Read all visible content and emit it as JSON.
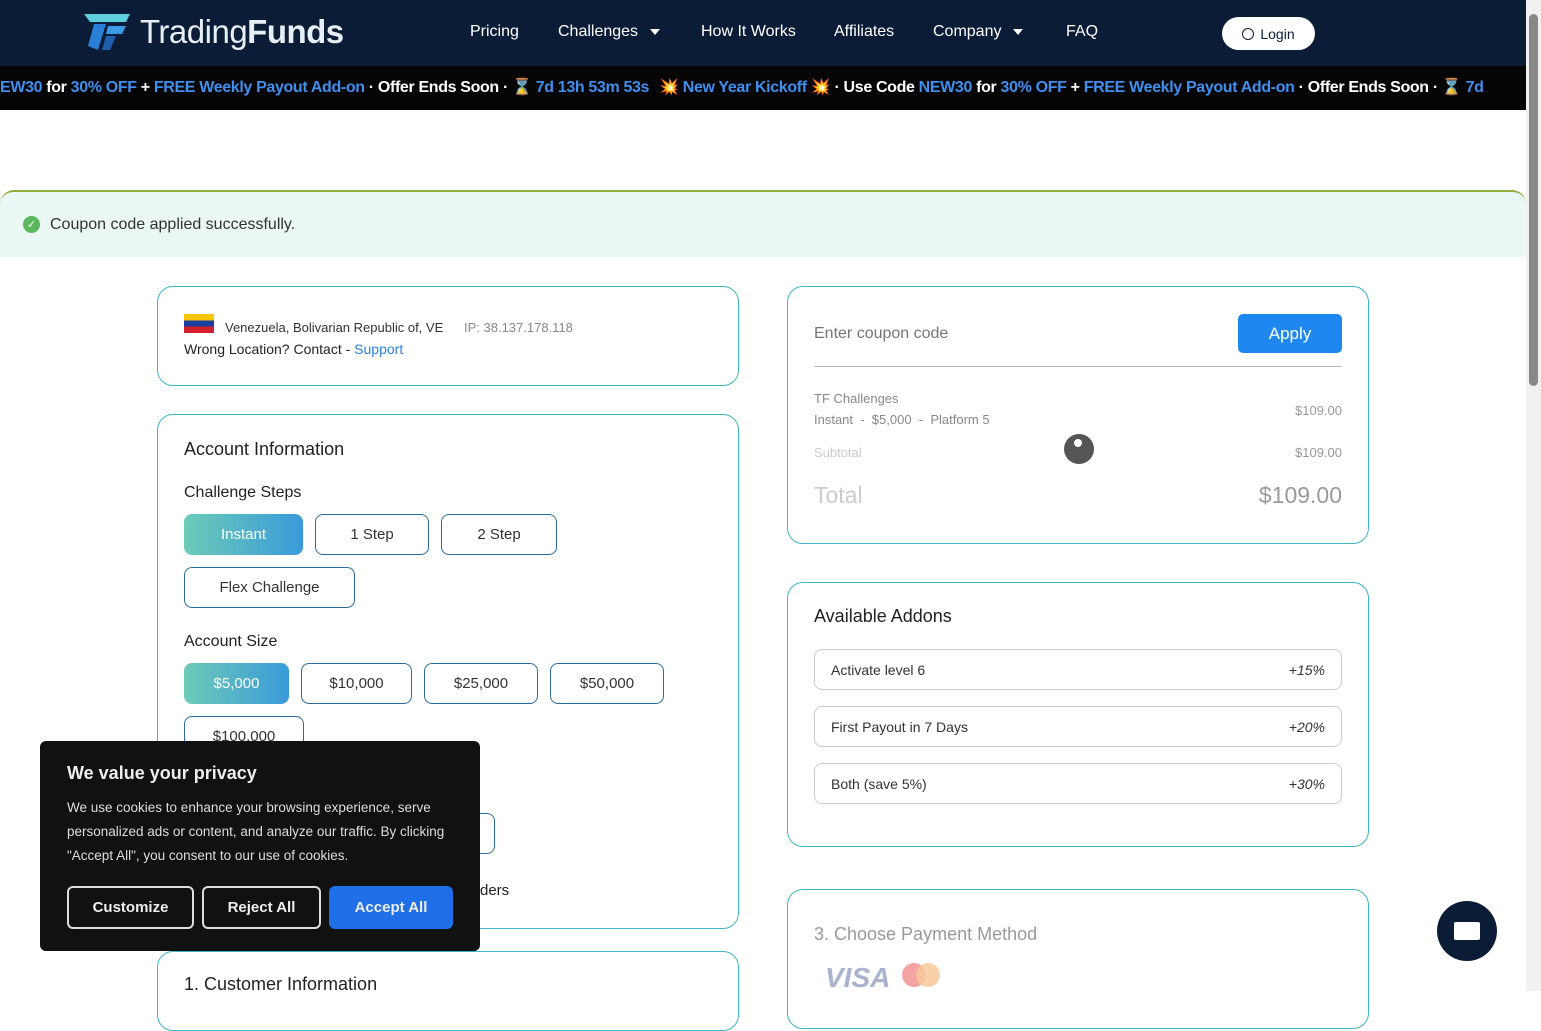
{
  "nav": {
    "brand_light": "Trading",
    "brand_bold": "Funds",
    "items": [
      "Pricing",
      "Challenges",
      "How It Works",
      "Affiliates",
      "Company",
      "FAQ"
    ],
    "login": "Login"
  },
  "ticker": {
    "seg1": "EW30",
    "seg2": " for ",
    "seg3": "30% OFF",
    "seg4": " + ",
    "seg5": "FREE Weekly Payout Add-on",
    "seg6": " · Offer Ends Soon · ",
    "seg7": "⌛ 7d 13h 53m 53s",
    "seg8": "💥 New Year Kickoff 💥",
    "seg9": " · Use Code ",
    "seg10": "NEW30",
    "seg11": " for ",
    "seg12": "30% OFF",
    "seg13": " + ",
    "seg14": "FREE Weekly Payout Add-on",
    "seg15": " · Offer Ends Soon · ",
    "seg16": "⌛ 7d"
  },
  "alert": "Coupon code applied successfully.",
  "location": {
    "country": "Venezuela, Bolivarian Republic of, VE",
    "ip": "IP: 38.137.178.118",
    "wrong": "Wrong Location? Contact - ",
    "support": "Support"
  },
  "account": {
    "title": "Account Information",
    "steps_label": "Challenge Steps",
    "steps": [
      "Instant",
      "1 Step",
      "2 Step",
      "Flex Challenge"
    ],
    "size_label": "Account Size",
    "sizes": [
      "$5,000",
      "$10,000",
      "$25,000",
      "$50,000",
      "$100,000"
    ],
    "partial": "ders"
  },
  "customer": {
    "title": "1. Customer Information"
  },
  "coupon": {
    "placeholder": "Enter coupon code",
    "apply": "Apply"
  },
  "summary": {
    "product": "TF Challenges",
    "detail": "Instant  -  $5,000  -  Platform 5",
    "price": "$109.00",
    "subtotal_label": "Subtotal",
    "subtotal": "$109.00",
    "total_label": "Total",
    "total": "$109.00"
  },
  "addons": {
    "title": "Available Addons",
    "items": [
      {
        "label": "Activate level 6",
        "value": "+15%"
      },
      {
        "label": "First Payout in 7 Days",
        "value": "+20%"
      },
      {
        "label": "Both (save 5%)",
        "value": "+30%"
      }
    ]
  },
  "payment": {
    "title": "3. Choose Payment Method",
    "visa": "VISA"
  },
  "cookie": {
    "title": "We value your privacy",
    "body": "We use cookies to enhance your browsing experience, serve personalized ads or content, and analyze our traffic. By clicking \"Accept All\", you consent to our use of cookies.",
    "customize": "Customize",
    "reject": "Reject All",
    "accept": "Accept All"
  }
}
